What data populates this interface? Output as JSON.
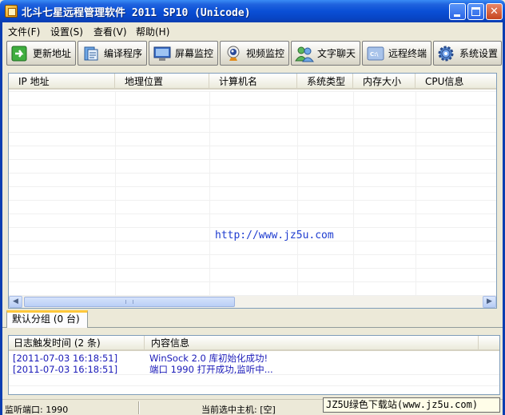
{
  "window": {
    "title": "北斗七星远程管理软件 2011 SP10 (Unicode)",
    "min_glyph": "_",
    "max_glyph": "□",
    "close_glyph": "✕"
  },
  "menu": [
    "文件(F)",
    "设置(S)",
    "查看(V)",
    "帮助(H)"
  ],
  "toolbar": [
    {
      "label": "更新地址",
      "icon": "refresh-arrow-icon"
    },
    {
      "label": "编译程序",
      "icon": "compile-icon"
    },
    {
      "label": "屏幕监控",
      "icon": "monitor-icon"
    },
    {
      "label": "视频监控",
      "icon": "webcam-icon"
    },
    {
      "label": "文字聊天",
      "icon": "chat-users-icon"
    },
    {
      "label": "远程终端",
      "icon": "terminal-icon"
    },
    {
      "label": "系统设置",
      "icon": "gear-icon"
    }
  ],
  "host_list": {
    "columns": [
      "IP 地址",
      "地理位置",
      "计算机名",
      "系统类型",
      "内存大小",
      "CPU信息"
    ],
    "rows": [],
    "watermark": "http://www.jz5u.com"
  },
  "scroll": {
    "left_arrow": "◀",
    "right_arrow": "▶"
  },
  "tabs": [
    {
      "label": "默认分组 (0 台)",
      "active": true
    }
  ],
  "log": {
    "columns": [
      "日志触发时间 (2 条)",
      "内容信息"
    ],
    "rows": [
      {
        "time": "[2011-07-03 16:18:51]",
        "message": "WinSock 2.0 库初始化成功!"
      },
      {
        "time": "[2011-07-03 16:18:51]",
        "message": "端口 1990 打开成功,监听中..."
      }
    ]
  },
  "status": {
    "port": "监听端口: 1990",
    "selected": "当前选中主机: [空]",
    "site": "JZ5U绿色下载站(www.jz5u.com)"
  },
  "colors": {
    "title_bar": "#0a4fd6",
    "log_text": "#1a1ab8",
    "link": "#1e3cd0",
    "tab_accent": "#ffc83c"
  }
}
